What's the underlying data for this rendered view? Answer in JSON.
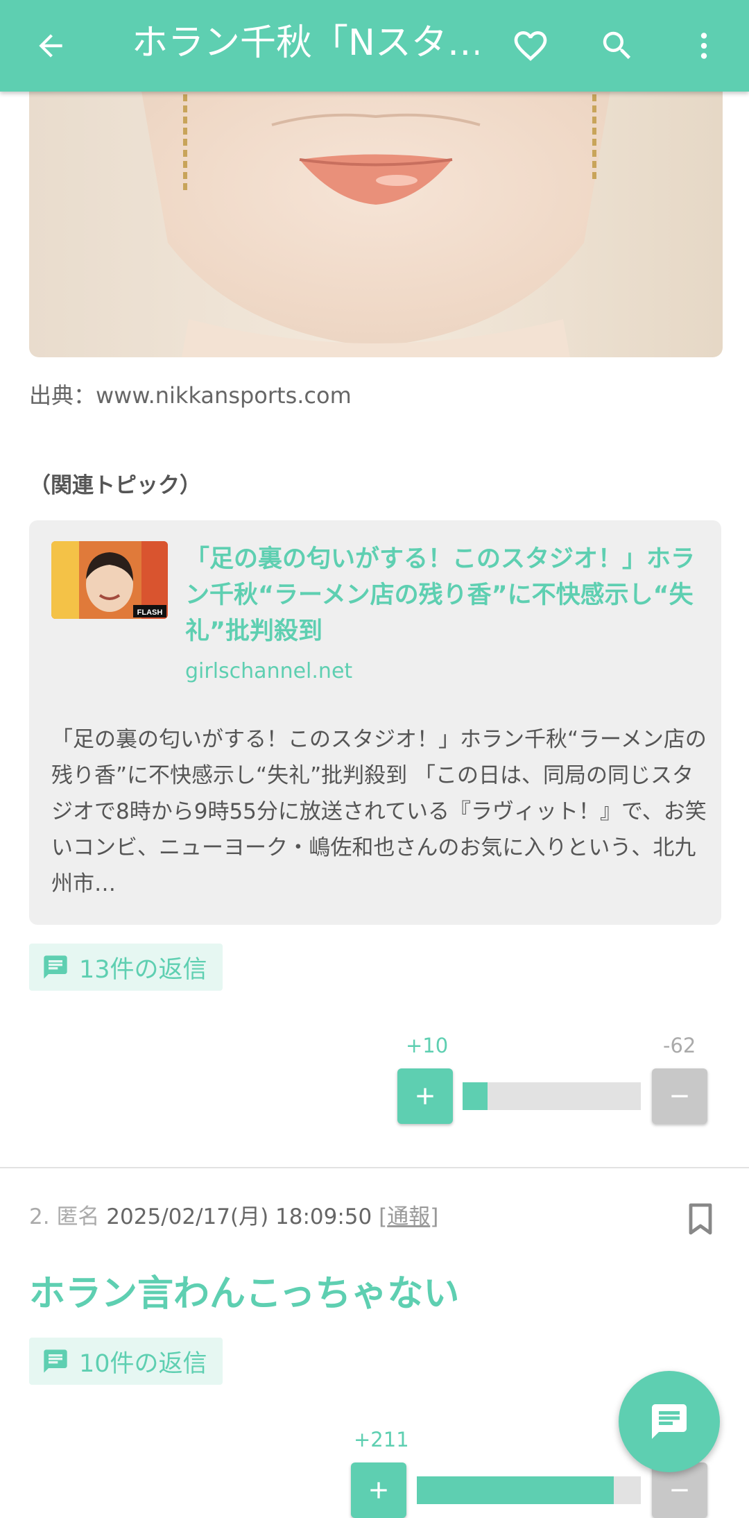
{
  "appbar": {
    "title": "ホラン千秋「Nスタ…",
    "back_icon": "arrow-left-icon",
    "favorite_icon": "heart-outline-icon",
    "search_icon": "search-icon",
    "menu_icon": "more-vert-icon"
  },
  "source": {
    "text": "出典：www.nikkansports.com"
  },
  "related": {
    "label": "（関連トピック）",
    "title": "「足の裏の匂いがする！このスタジオ！」ホラン千秋“ラーメン店の残り香”に不快感示し“失礼”批判殺到",
    "domain": "girlschannel.net",
    "excerpt": "「足の裏の匂いがする！このスタジオ！」ホラン千秋“ラーメン店の残り香”に不快感示し“失礼”批判殺到 「この日は、同局の同じスタジオで8時から9時55分に放送されている『ラヴィット！』で、お笑いコンビ、ニューヨーク・嶋佐和也さんのお気に入りという、北九州市…",
    "thumb_badge": "FLASH"
  },
  "comment1": {
    "replies": "13件の返信",
    "plus": "+10",
    "minus": "-62",
    "plus_fraction": 0.139
  },
  "comment2": {
    "number": "2.",
    "author": "匿名",
    "datetime": "2025/02/17(月) 18:09:50",
    "report_open": "[",
    "report": "通報",
    "report_close": "]",
    "body": "ホラン言わんこっちゃない",
    "replies": "10件の返信",
    "plus": "+211",
    "plus_fraction": 0.88
  },
  "colors": {
    "accent": "#5ecfb1",
    "chip_bg": "#e6f7f2",
    "minus": "#c8c8c8"
  }
}
